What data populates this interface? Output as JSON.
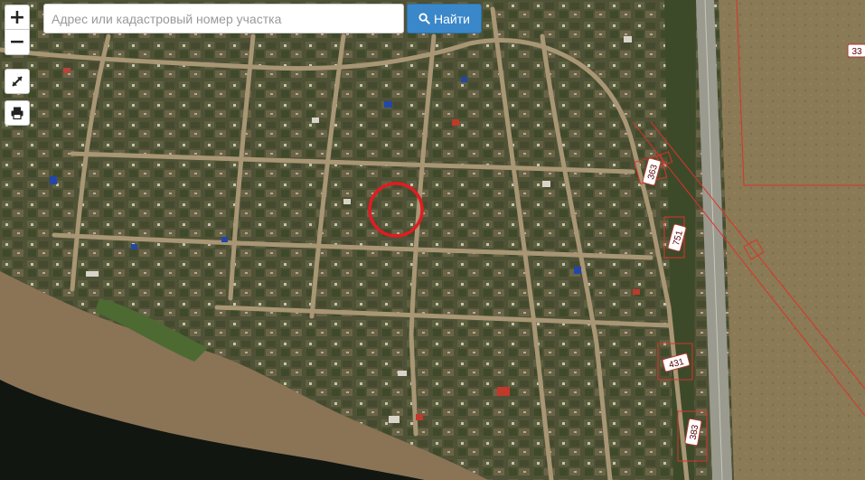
{
  "search": {
    "placeholder": "Адрес или кадастровый номер участка",
    "button_label": "Найти",
    "button_color": "#3a87c9"
  },
  "controls": {
    "zoom_in": "+",
    "zoom_out": "−",
    "fullscreen_icon": "expand-arrows-icon",
    "print_icon": "printer-icon"
  },
  "map": {
    "type": "satellite",
    "marker_color": "#e31b23",
    "boundary_color": "#d9342b",
    "plots": [
      {
        "number": "363"
      },
      {
        "number": "751"
      },
      {
        "number": "431"
      },
      {
        "number": "383"
      },
      {
        "number": "33"
      }
    ]
  }
}
